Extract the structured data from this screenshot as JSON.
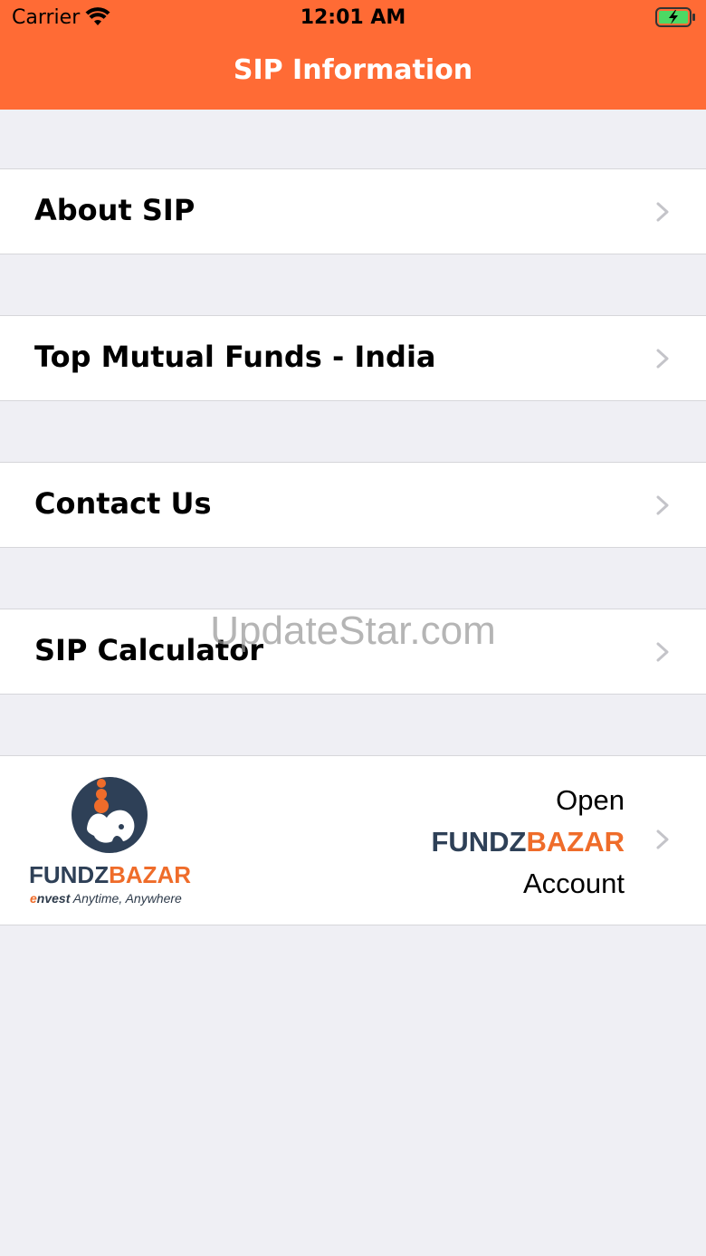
{
  "status_bar": {
    "carrier": "Carrier",
    "time": "12:01 AM"
  },
  "nav": {
    "title": "SIP Information"
  },
  "menu": [
    {
      "label": "About SIP"
    },
    {
      "label": "Top Mutual Funds - India"
    },
    {
      "label": "Contact Us"
    },
    {
      "label": "SIP Calculator"
    }
  ],
  "watermark": "UpdateStar.com",
  "promo": {
    "logo_part1": "FUNDZ",
    "logo_part2": "BAZAR",
    "tagline_prefix": "e",
    "tagline_bold": "nvest",
    "tagline": " Anytime, Anywhere",
    "line1": "Open",
    "brand_part1": "FUNDZ",
    "brand_part2": "BAZAR",
    "line3": "Account"
  },
  "colors": {
    "nav_bg": "#ff6b35",
    "brand_dark": "#2e4057",
    "brand_orange": "#ef6c2a"
  }
}
